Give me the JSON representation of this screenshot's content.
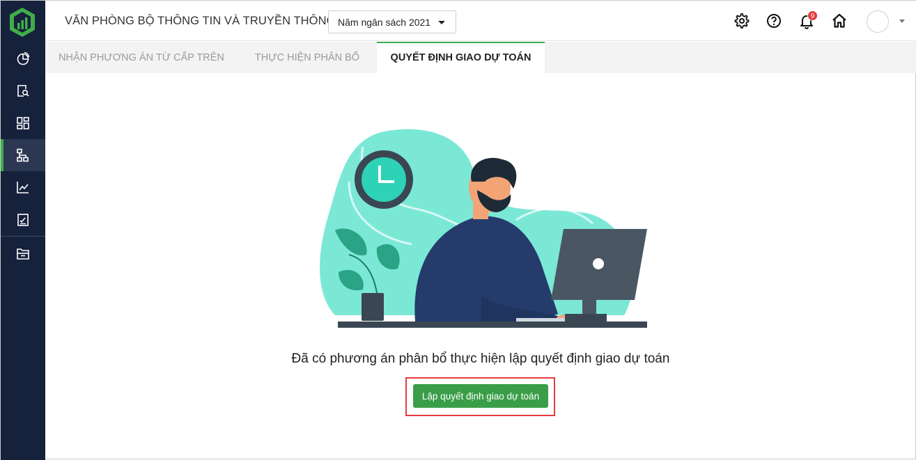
{
  "header": {
    "org_title": "VĂN PHÒNG BỘ THÔNG TIN VÀ TRUYỀN THÔNG",
    "year_select_value": "Năm ngân sách 2021",
    "notification_count": "9"
  },
  "tabs": [
    {
      "label": "NHẬN PHƯƠNG ÁN TỪ CẤP TRÊN"
    },
    {
      "label": "THỰC HIỆN PHÂN BỔ"
    },
    {
      "label": "QUYẾT ĐỊNH GIAO DỰ TOÁN"
    }
  ],
  "sidebar": {
    "items": [
      {
        "icon": "pie-chart-icon"
      },
      {
        "icon": "document-search-icon"
      },
      {
        "icon": "dashboard-grid-icon"
      },
      {
        "icon": "hierarchy-icon",
        "active": true
      },
      {
        "icon": "line-chart-icon"
      },
      {
        "icon": "report-icon"
      },
      {
        "icon": "archive-icon"
      }
    ]
  },
  "main": {
    "message": "Đã có phương án phân bổ thực hiện lập quyết định giao dự toán",
    "action_label": "Lập quyết định giao dự toán"
  },
  "colors": {
    "sidebar_bg": "#16213c",
    "accent_green": "#3fae49",
    "button_green": "#3a9e48",
    "highlight_red": "#e43c3c"
  }
}
